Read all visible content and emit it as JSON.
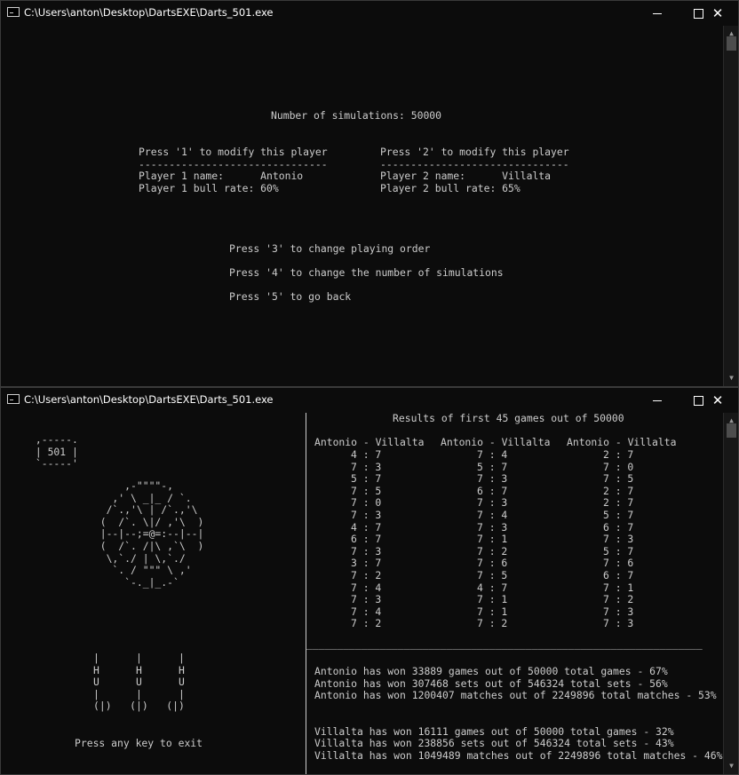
{
  "window1": {
    "title": "C:\\Users\\anton\\Desktop\\DartsEXE\\Darts_501.exe",
    "num_simulations": "Number of simulations: 50000",
    "p1_header": "Press '1' to modify this player",
    "p1_divider": "-------------------------------",
    "p1_name": "Player 1 name:      Antonio",
    "p1_bull": "Player 1 bull rate: 60%",
    "p2_header": "Press '2' to modify this player",
    "p2_divider": "-------------------------------",
    "p2_name": "Player 2 name:      Villalta",
    "p2_bull": "Player 2 bull rate: 65%",
    "opt3": "Press '3' to change playing order",
    "opt4": "Press '4' to change the number of simulations",
    "opt5": "Press '5' to go back"
  },
  "window2": {
    "title": "C:\\Users\\anton\\Desktop\\DartsEXE\\Darts_501.exe",
    "scoreboard": " ,-----.\n | 501 |\n `-----'",
    "dartboard": "      ,-\"\"\"\"-,\n    ,' \\ _|_ / `.\n   /`.,'\\ | /`.,'\\\n  (  /`. \\|/ ,'\\  )\n  |--|--;=@=:--|--|\n  (  /`. /|\\ ,`\\  )\n   \\,`./ | \\,`./\n    `. / \"\"\" \\ ,'\n      `-._|_.-`",
    "darts": "|      |      |\nH      H      H\nU      U      U\n|      |      |\n(|)   (|)   (|)",
    "exit_prompt": "Press any key to exit",
    "results_header": "Results of first 45 games out of 50000",
    "col_headers": [
      "Antonio - Villalta",
      "Antonio - Villalta",
      "Antonio - Villalta"
    ],
    "results": [
      [
        "4 : 7",
        "7 : 4",
        "2 : 7"
      ],
      [
        "7 : 3",
        "5 : 7",
        "7 : 0"
      ],
      [
        "5 : 7",
        "7 : 3",
        "7 : 5"
      ],
      [
        "7 : 5",
        "6 : 7",
        "2 : 7"
      ],
      [
        "7 : 0",
        "7 : 3",
        "2 : 7"
      ],
      [
        "7 : 3",
        "7 : 4",
        "5 : 7"
      ],
      [
        "4 : 7",
        "7 : 3",
        "6 : 7"
      ],
      [
        "6 : 7",
        "7 : 1",
        "7 : 3"
      ],
      [
        "7 : 3",
        "7 : 2",
        "5 : 7"
      ],
      [
        "3 : 7",
        "7 : 6",
        "7 : 6"
      ],
      [
        "7 : 2",
        "7 : 5",
        "6 : 7"
      ],
      [
        "7 : 4",
        "4 : 7",
        "7 : 1"
      ],
      [
        "7 : 3",
        "7 : 1",
        "7 : 2"
      ],
      [
        "7 : 4",
        "7 : 1",
        "7 : 3"
      ],
      [
        "7 : 2",
        "7 : 2",
        "7 : 3"
      ]
    ],
    "separator": "_________________________________________________________________",
    "p1_games": "Antonio has won 33889 games out of 50000 total games - 67%",
    "p1_sets": "Antonio has won 307468 sets out of 546324 total sets - 56%",
    "p1_matches": "Antonio has won 1200407 matches out of 2249896 total matches - 53%",
    "p2_games": "Villalta has won 16111 games out of 50000 total games - 32%",
    "p2_sets": "Villalta has won 238856 sets out of 546324 total sets - 43%",
    "p2_matches": "Villalta has won 1049489 matches out of 2249896 total matches - 46%"
  }
}
